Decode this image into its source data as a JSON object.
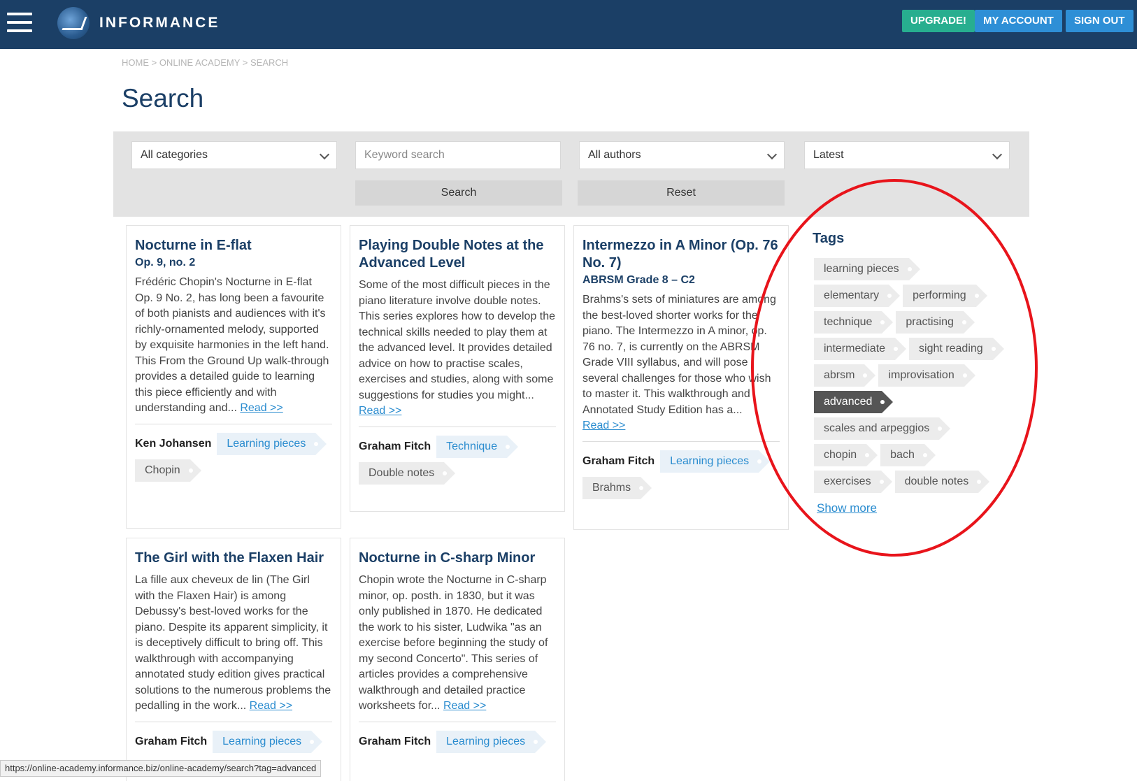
{
  "header": {
    "brand": "INFORMANCE",
    "upgrade": "UPGRADE!",
    "my_account": "MY ACCOUNT",
    "sign_out": "SIGN OUT",
    "colors": {
      "bar": "#1b3f66",
      "upgrade": "#27ae8f",
      "account": "#2e8fd6"
    }
  },
  "breadcrumb": "HOME > ONLINE ACADEMY > SEARCH",
  "page_title": "Search",
  "filters": {
    "categories": "All categories",
    "keyword_placeholder": "Keyword search",
    "authors": "All authors",
    "sort": "Latest",
    "search_btn": "Search",
    "reset_btn": "Reset"
  },
  "cards": [
    {
      "title": "Nocturne in E-flat",
      "subtitle": "Op. 9, no. 2",
      "body": "Frédéric Chopin's Nocturne in E-flat Op. 9 No. 2, has long been a favourite of both pianists and audiences with it's richly-ornamented melody, supported by exquisite harmonies in the left hand. This From the Ground Up walk-through provides a detailed guide to learning this piece efficiently and with understanding and... ",
      "read": "Read >>",
      "author": "Ken Johansen",
      "tags": [
        "Learning pieces",
        "Chopin"
      ]
    },
    {
      "title": "Playing Double Notes at the Advanced Level",
      "subtitle": "",
      "body": "Some of the most difficult pieces in the piano literature involve double notes. This series explores how to develop the technical skills needed to play them at the advanced level. It provides detailed advice on how to practise scales, exercises and studies, along with some suggestions for studies you might...",
      "read": "Read >>",
      "author": "Graham Fitch",
      "tags": [
        "Technique",
        "Double notes"
      ]
    },
    {
      "title": "Intermezzo in A Minor (Op. 76 No. 7)",
      "subtitle": "ABRSM Grade 8 – C2",
      "body": "Brahms's sets of miniatures are among the best-loved shorter works for the piano. The Intermezzo in A minor, op. 76 no. 7, is currently on the ABRSM Grade VIII syllabus, and will pose several challenges for those who wish to master it. This walkthrough and Annotated Study Edition has a...",
      "read": "Read >>",
      "author": "Graham Fitch",
      "tags": [
        "Learning pieces",
        "Brahms"
      ]
    },
    {
      "title": "The Girl with the Flaxen Hair",
      "subtitle": "",
      "body": "La fille aux cheveux de lin (The Girl with the Flaxen Hair) is among Debussy's best-loved works for the piano. Despite its apparent simplicity, it is deceptively difficult to bring off. This walkthrough with accompanying annotated study edition gives practical solutions to the numerous problems the pedalling in the work... ",
      "read": "Read >>",
      "author": "Graham Fitch",
      "tags": [
        "Learning pieces"
      ]
    },
    {
      "title": "Nocturne in C-sharp Minor",
      "subtitle": "",
      "body": "Chopin wrote the Nocturne in C-sharp minor, op. posth. in 1830, but it was only published in 1870. He dedicated the work to his sister, Ludwika \"as an exercise before beginning the study of my second Concerto\". This series of articles provides a comprehensive walkthrough and detailed practice worksheets for... ",
      "read": "Read >>",
      "author": "Graham Fitch",
      "tags": [
        "Learning pieces"
      ]
    }
  ],
  "tags": {
    "title": "Tags",
    "rows": [
      [
        "learning pieces"
      ],
      [
        "elementary",
        "performing"
      ],
      [
        "technique",
        "practising"
      ],
      [
        "intermediate",
        "sight reading"
      ],
      [
        "abrsm",
        "improvisation"
      ],
      [
        "advanced"
      ],
      [
        "scales and arpeggios"
      ],
      [
        "chopin",
        "bach"
      ],
      [
        "exercises",
        "double notes"
      ]
    ],
    "active": "advanced",
    "show_more": "Show more"
  },
  "status_bar": "https://online-academy.informance.biz/online-academy/search?tag=advanced",
  "annotation_color": "#e8141b"
}
